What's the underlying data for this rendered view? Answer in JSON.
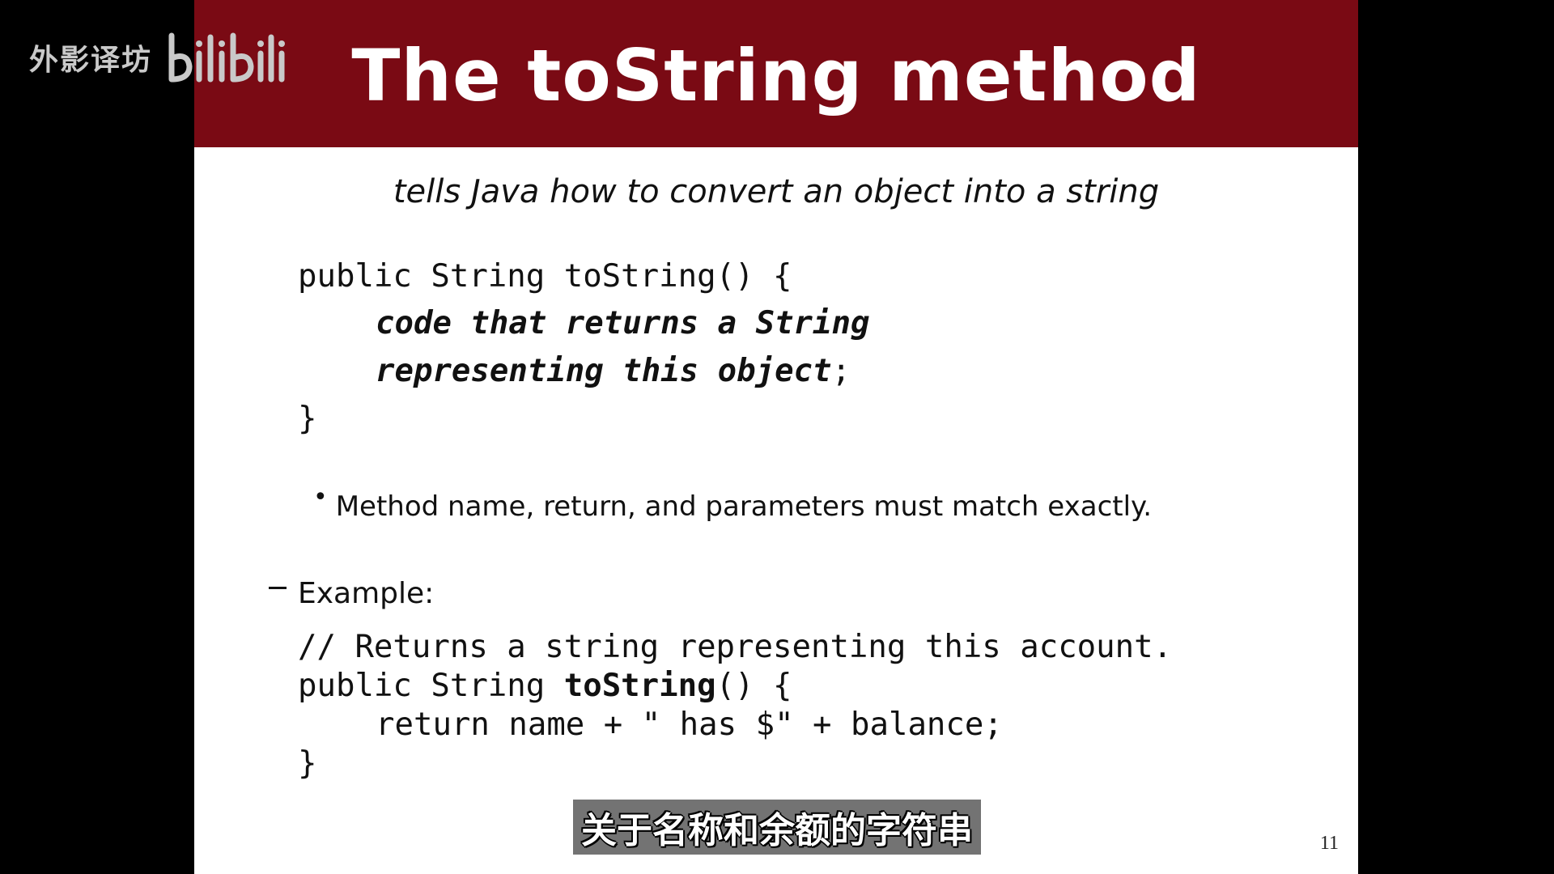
{
  "watermark": {
    "channel": "外影译坊",
    "logo": "bilibili"
  },
  "slide": {
    "title": "The toString method",
    "subtitle": "tells Java how to convert an object into a string",
    "syntax": {
      "line1": "public String toString() {",
      "line2": "code that returns a String",
      "line3_text": "representing this object",
      "line3_semicolon": ";",
      "line4": "}"
    },
    "bullet": "Method name, return, and parameters must match exactly.",
    "example_label": "Example:",
    "example": {
      "comment": "// Returns a string representing this account.",
      "sig_prefix": "public String ",
      "sig_method": "toString",
      "sig_suffix": "() {",
      "body": "return name + \" has $\" + balance;",
      "close": "}"
    },
    "page_number": "11"
  },
  "caption": "关于名称和余额的字符串",
  "colors": {
    "title_bar": "#7a0a14",
    "background": "#000000",
    "slide": "#ffffff"
  }
}
